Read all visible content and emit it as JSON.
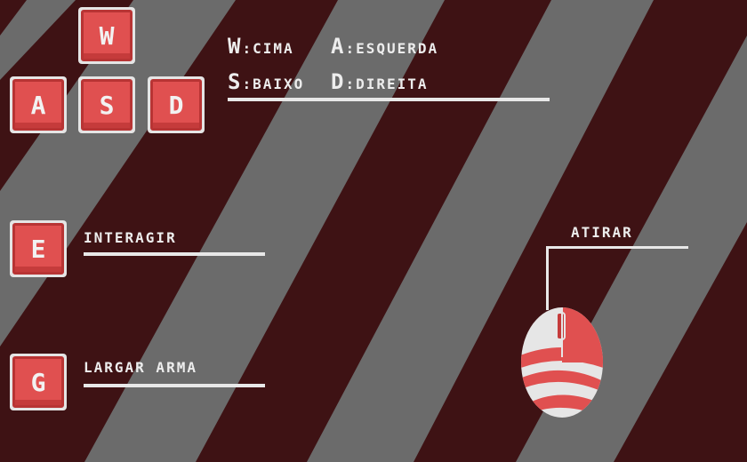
{
  "keys": {
    "w": "W",
    "a": "A",
    "s": "S",
    "d": "D",
    "e": "E",
    "g": "G"
  },
  "movement": {
    "up_key": "W",
    "up_text": ":CIMA",
    "left_key": "A",
    "left_text": ":ESQUERDA",
    "down_key": "S",
    "down_text": ":BAIXO",
    "right_key": "D",
    "right_text": ":DIREITA"
  },
  "actions": {
    "interact": "INTERAGIR",
    "drop_weapon": "LARGAR ARMA",
    "shoot": "ATIRAR"
  },
  "colors": {
    "stripe_dark": "#3e1214",
    "stripe_gray": "#6b6b6b",
    "key_red": "#e05050",
    "text": "#ededed"
  }
}
